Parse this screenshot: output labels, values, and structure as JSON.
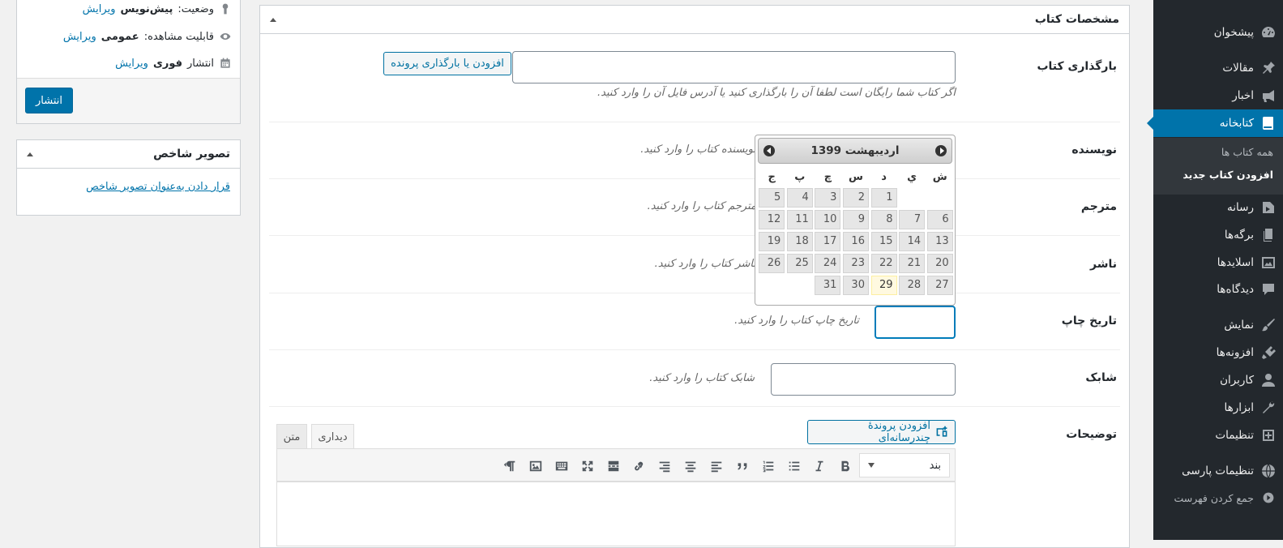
{
  "sidebar": {
    "items": [
      {
        "label": "پیشخوان",
        "icon": "dashboard-icon"
      },
      {
        "label": "مقالات",
        "icon": "pin-icon"
      },
      {
        "label": "اخبار",
        "icon": "megaphone-icon"
      },
      {
        "label": "کتابخانه",
        "icon": "book-icon",
        "current": true
      },
      {
        "label": "رسانه",
        "icon": "media-icon"
      },
      {
        "label": "برگه‌ها",
        "icon": "pages-icon"
      },
      {
        "label": "اسلایدها",
        "icon": "slides-icon"
      },
      {
        "label": "دیدگاه‌ها",
        "icon": "comment-icon"
      },
      {
        "label": "نمایش",
        "icon": "brush-icon"
      },
      {
        "label": "افزونه‌ها",
        "icon": "plugin-icon"
      },
      {
        "label": "کاربران",
        "icon": "user-icon"
      },
      {
        "label": "ابزارها",
        "icon": "wrench-icon"
      },
      {
        "label": "تنظیمات",
        "icon": "settings-icon"
      },
      {
        "label": "تنظیمات پارسی",
        "icon": "globe-icon"
      },
      {
        "label": "جمع کردن فهرست",
        "icon": "collapse-icon"
      }
    ],
    "submenu": [
      "همه کتاب ها",
      "افزودن کتاب جدید"
    ]
  },
  "book_box": {
    "title": "مشخصات کتاب",
    "upload": {
      "label": "بارگذاری کتاب",
      "button": "افزودن یا بارگذاری پرونده",
      "help": "اگر کتاب شما رایگان است لطفا آن را بارگذاری کنید یا آدرس فایل آن را وارد کنید."
    },
    "author": {
      "label": "نویسنده",
      "help": "نویسنده کتاب را وارد کنید."
    },
    "translator": {
      "label": "مترجم",
      "help": "مترجم کتاب را وارد کنید."
    },
    "publisher": {
      "label": "ناشر",
      "help": "ناشر کتاب را وارد کنید."
    },
    "print_date": {
      "label": "تاریخ چاپ",
      "help": "تاریخ چاپ کتاب را وارد کنید."
    },
    "isbn": {
      "label": "شابک",
      "help": "شابک کتاب را وارد کنید."
    },
    "description": {
      "label": "توضیحات",
      "add_media": "افزودن پروندهٔ چندرسانه‌ای",
      "tab_visual": "دیداری",
      "tab_text": "متن",
      "format_value": "بند"
    }
  },
  "datepicker": {
    "title": "اردیبهشت 1399",
    "weekdays": [
      "ش",
      "ي",
      "د",
      "س",
      "چ",
      "پ",
      "ج"
    ],
    "weeks": [
      [
        "",
        "",
        "1",
        "2",
        "3",
        "4",
        "5"
      ],
      [
        "6",
        "7",
        "8",
        "9",
        "10",
        "11",
        "12"
      ],
      [
        "13",
        "14",
        "15",
        "16",
        "17",
        "18",
        "19"
      ],
      [
        "20",
        "21",
        "22",
        "23",
        "24",
        "25",
        "26"
      ],
      [
        "27",
        "28",
        "29",
        "30",
        "31",
        "",
        ""
      ]
    ],
    "today": "29"
  },
  "publish_box": {
    "status_label": "وضعیت:",
    "status_value": "پیش‌نویس",
    "visibility_label": "قابلیت مشاهده:",
    "visibility_value": "عمومی",
    "publish_label": "انتشار",
    "publish_value": "فوری",
    "edit_link": "ویرایش",
    "publish_button": "انتشار"
  },
  "thumbnail_box": {
    "title": "تصویر شاخص",
    "link": "قرار دادن به‌عنوان تصویر شاخص"
  }
}
